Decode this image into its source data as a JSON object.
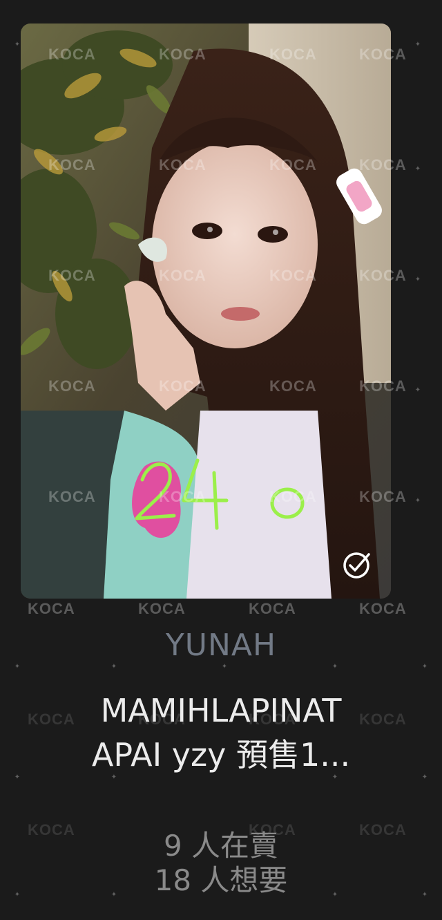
{
  "card": {
    "handwriting": "240",
    "status_icon": "check-circle-icon",
    "watermark": "KOCA"
  },
  "member": "YUNAH",
  "title": "MAMIHLAPINATAPAI yzy 預售1...",
  "title_line1": "MAMIHLAPINAT",
  "title_line2": "APAI yzy 預售1...",
  "stats": {
    "selling": "9 人在賣",
    "wanting": "18 人想要"
  },
  "colors": {
    "background": "#1b1b1b",
    "member_text": "#727a86",
    "title_text": "#ececec",
    "stats_text": "#8a8a8a",
    "handwriting": "#9bef4a"
  }
}
